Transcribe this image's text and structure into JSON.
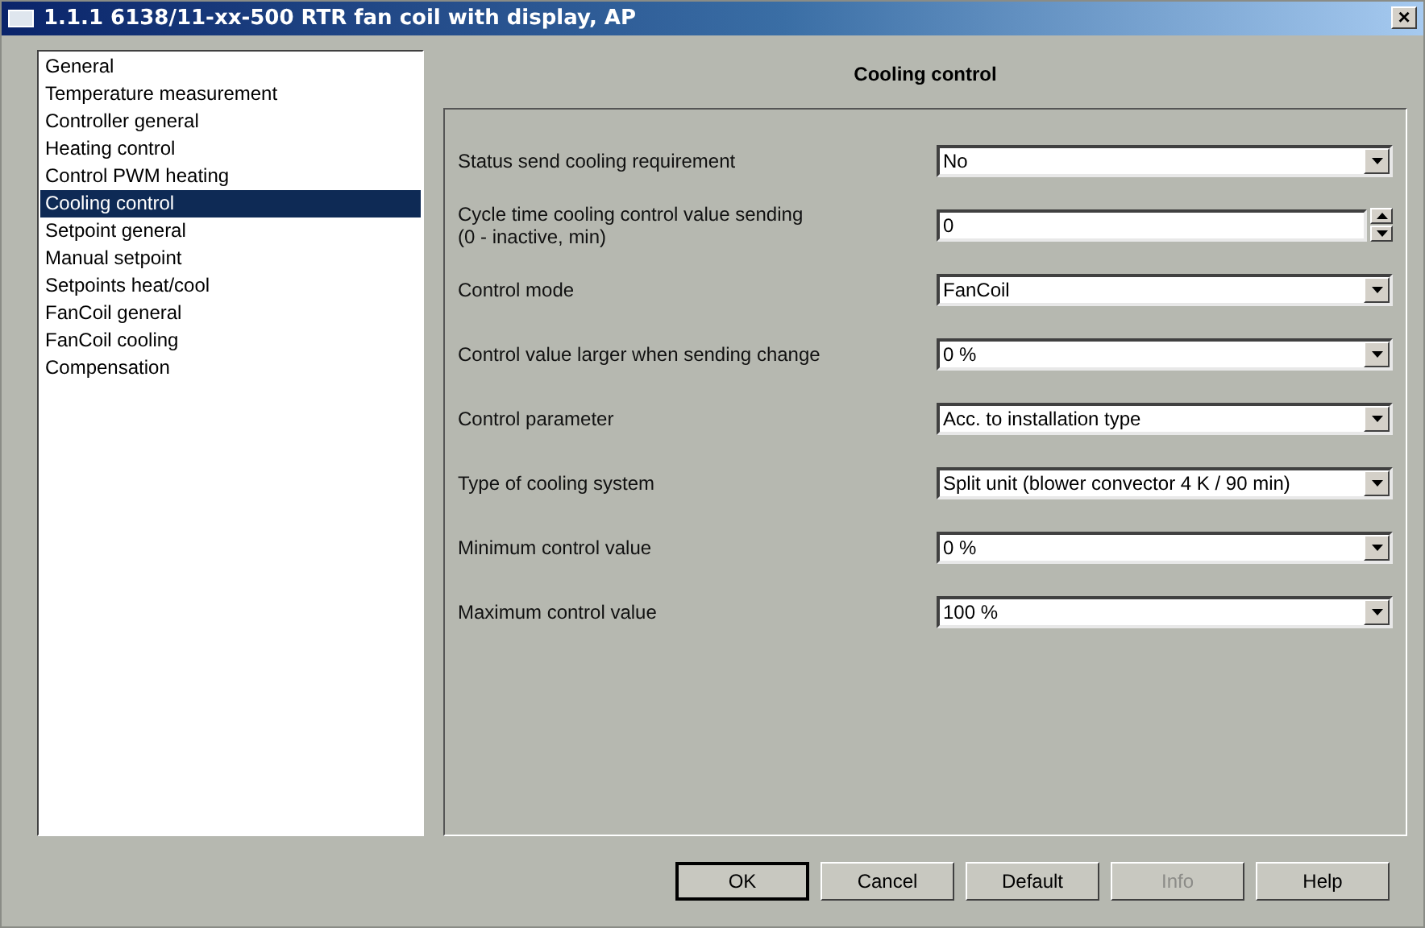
{
  "window": {
    "title": "1.1.1 6138/11-xx-500 RTR fan coil with display, AP",
    "close": "×"
  },
  "sidebar": {
    "items": [
      {
        "label": "General",
        "selected": false
      },
      {
        "label": "Temperature measurement",
        "selected": false
      },
      {
        "label": "Controller general",
        "selected": false
      },
      {
        "label": "Heating control",
        "selected": false
      },
      {
        "label": "Control PWM heating",
        "selected": false
      },
      {
        "label": "Cooling control",
        "selected": true
      },
      {
        "label": "Setpoint general",
        "selected": false
      },
      {
        "label": "Manual setpoint",
        "selected": false
      },
      {
        "label": "Setpoints heat/cool",
        "selected": false
      },
      {
        "label": "FanCoil general",
        "selected": false
      },
      {
        "label": "FanCoil cooling",
        "selected": false
      },
      {
        "label": "Compensation",
        "selected": false
      }
    ]
  },
  "panel": {
    "title": "Cooling control",
    "rows": [
      {
        "kind": "dropdown",
        "label": "Status send cooling requirement",
        "value": "No"
      },
      {
        "kind": "spinner",
        "label": "Cycle time cooling control value sending",
        "sublabel": "(0 - inactive, min)",
        "value": "0"
      },
      {
        "kind": "dropdown",
        "label": "Control mode",
        "value": "FanCoil"
      },
      {
        "kind": "dropdown",
        "label": "Control value larger when sending change",
        "value": "0 %"
      },
      {
        "kind": "dropdown",
        "label": "Control parameter",
        "value": "Acc. to installation type"
      },
      {
        "kind": "dropdown",
        "label": "Type of cooling system",
        "value": "Split unit (blower convector 4 K / 90 min)"
      },
      {
        "kind": "dropdown",
        "label": "Minimum control value",
        "value": "0 %"
      },
      {
        "kind": "dropdown",
        "label": "Maximum control value",
        "value": "100 %"
      }
    ]
  },
  "buttons": [
    {
      "label": "OK",
      "default": true,
      "disabled": false
    },
    {
      "label": "Cancel",
      "default": false,
      "disabled": false
    },
    {
      "label": "Default",
      "default": false,
      "disabled": false
    },
    {
      "label": "Info",
      "default": false,
      "disabled": true
    },
    {
      "label": "Help",
      "default": false,
      "disabled": false
    }
  ]
}
